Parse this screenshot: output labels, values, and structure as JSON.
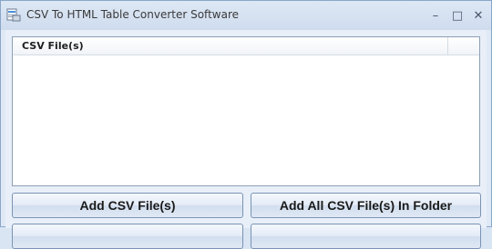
{
  "window": {
    "title": "CSV To HTML Table Converter Software",
    "controls": {
      "minimize": "–",
      "maximize": "□",
      "close": "✕"
    }
  },
  "list": {
    "columns": [
      "CSV File(s)"
    ],
    "rows": []
  },
  "buttons": {
    "add_files": "Add CSV File(s)",
    "add_folder": "Add All CSV File(s) In Folder"
  },
  "colors": {
    "window_bg": "#dfe9f5",
    "button_border": "#7a93b5"
  }
}
